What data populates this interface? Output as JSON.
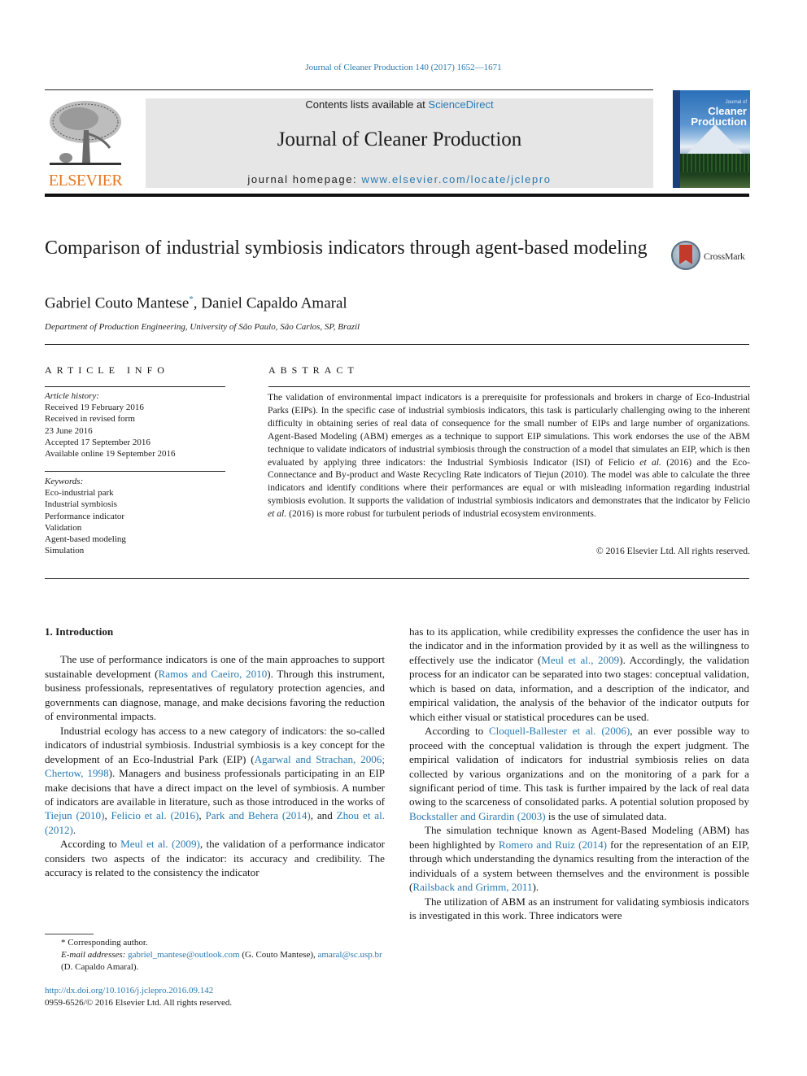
{
  "citation": "Journal of Cleaner Production 140 (2017) 1652—1671",
  "header": {
    "publisher_logo": "ELSEVIER",
    "contents_prefix": "Contents lists available at ",
    "contents_link": "ScienceDirect",
    "journal_name": "Journal of Cleaner Production",
    "homepage_prefix": "journal homepage: ",
    "homepage_link": "www.elsevier.com/locate/jclepro",
    "cover": {
      "title_small": "Journal of",
      "title_line1": "Cleaner",
      "title_line2": "Production"
    }
  },
  "article": {
    "title": "Comparison of industrial symbiosis indicators through agent-based modeling",
    "crossmark_label": "CrossMark",
    "author1": "Gabriel Couto Mantese",
    "author1_mark": "*",
    "author_sep": ", ",
    "author2": "Daniel Capaldo Amaral",
    "affiliation": "Department of Production Engineering, University of São Paulo, São Carlos, SP, Brazil"
  },
  "article_info": {
    "heading": "ARTICLE INFO",
    "history_label": "Article history:",
    "history": [
      "Received 19 February 2016",
      "Received in revised form",
      "23 June 2016",
      "Accepted 17 September 2016",
      "Available online 19 September 2016"
    ],
    "keywords_label": "Keywords:",
    "keywords": [
      "Eco-industrial park",
      "Industrial symbiosis",
      "Performance indicator",
      "Validation",
      "Agent-based modeling",
      "Simulation"
    ]
  },
  "abstract": {
    "heading": "ABSTRACT",
    "part1": "The validation of environmental impact indicators is a prerequisite for professionals and brokers in charge of Eco-Industrial Parks (EIPs). In the specific case of industrial symbiosis indicators, this task is particularly challenging owing to the inherent difficulty in obtaining series of real data of consequence for the small number of EIPs and large number of organizations. Agent-Based Modeling (ABM) emerges as a technique to support EIP simulations. This work endorses the use of the ABM technique to validate indicators of industrial symbiosis through the construction of a model that simulates an EIP, which is then evaluated by applying three indicators: the Industrial Symbiosis Indicator (ISI) of Felicio ",
    "etal1": "et al.",
    "part2": " (2016) and the Eco-Connectance and By-product and Waste Recycling Rate indicators of Tiejun (2010). The model was able to calculate the three indicators and identify conditions where their performances are equal or with misleading information regarding industrial symbiosis evolution. It supports the validation of industrial symbiosis indicators and demonstrates that the indicator by Felicio ",
    "etal2": "et al.",
    "part3": " (2016) is more robust for turbulent periods of industrial ecosystem environments.",
    "copyright": "© 2016 Elsevier Ltd. All rights reserved."
  },
  "body": {
    "section_heading": "1.  Introduction",
    "p1": {
      "t1": "The use of performance indicators is one of the main approaches to support sustainable development (",
      "l1": "Ramos and Caeiro, 2010",
      "t2": "). Through this instrument, business professionals, representatives of regulatory protection agencies, and governments can diagnose, manage, and make decisions favoring the reduction of environ­mental impacts."
    },
    "p2": {
      "t1": "Industrial ecology has access to a new category of indicators: the so-called indicators of industrial symbiosis. Industrial symbiosis is a key concept for the development of an Eco-Industrial Park (EIP) (",
      "l1": "Agarwal and Strachan, 2006; Chertow, 1998",
      "t2": "). Managers and business professionals participating in an EIP make decisions that have a direct impact on the level of symbiosis. A number of in­dicators are available in literature, such as those introduced in the works of ",
      "l2": "Tiejun (2010)",
      "t3": ", ",
      "l3": "Felicio et al. (2016)",
      "t4": ", ",
      "l4": "Park and Behera (2014)",
      "t5": ", and ",
      "l5": "Zhou et al. (2012)",
      "t6": "."
    },
    "p3": {
      "t1": "According to ",
      "l1": "Meul et al. (2009)",
      "t2": ", the validation of a performance indicator considers two aspects of the indicator: its accuracy and credibility. The accuracy is related to the consistency the indicator has to its application, while credibility expresses the confidence the user has in the indicator and in the information provided by it as well as the willingness to effectively use the indicator (",
      "l2": "Meul et al., 2009",
      "t3": "). Accordingly, the validation process for an indicator can be separated into two stages: conceptual validation, which is based on data, information, and a description of the indicator, and empirical validation, the analysis of the behavior of the indicator outputs for which either visual or statistical procedures can be used."
    },
    "p4": {
      "t1": "According to ",
      "l1": "Cloquell-Ballester et al. (2006)",
      "t2": ", an ever possible way to proceed with the conceptual validation is through the expert judgment. The empirical validation of indicators for indus­trial symbiosis relies on data collected by various organizations and on the monitoring of a park for a significant period of time. This task is further impaired by the lack of real data owing to the scarceness of consolidated parks. A potential solution proposed by ",
      "l2": "Bockstaller and Girardin (2003)",
      "t3": " is the use of simulated data."
    },
    "p5": {
      "t1": "The simulation technique known as Agent-Based Modeling (ABM) has been highlighted by ",
      "l1": "Romero and Ruiz (2014)",
      "t2": " for the representation of an EIP, through which understanding the dy­namics resulting from the interaction of the individuals of a system between themselves and the environment is possible (",
      "l2": "Railsback and Grimm, 2011",
      "t3": ")."
    },
    "p6": {
      "t1": "The utilization of ABM as an instrument for validating symbiosis indicators is investigated in this work. Three indicators were"
    }
  },
  "footnotes": {
    "corresponding": "* Corresponding author.",
    "email_label": "E-mail addresses:",
    "email1": "gabriel_mantese@outlook.com",
    "email1_name": " (G. Couto Mantese), ",
    "email2": "amaral@sc.usp.br",
    "email2_name": " (D. Capaldo Amaral).",
    "doi": "http://dx.doi.org/10.1016/j.jclepro.2016.09.142",
    "issn": "0959-6526/© 2016 Elsevier Ltd. All rights reserved."
  },
  "colors": {
    "link": "#2a7ab0",
    "elsevier_orange": "#e87722",
    "header_bg": "#e6e6e6"
  }
}
